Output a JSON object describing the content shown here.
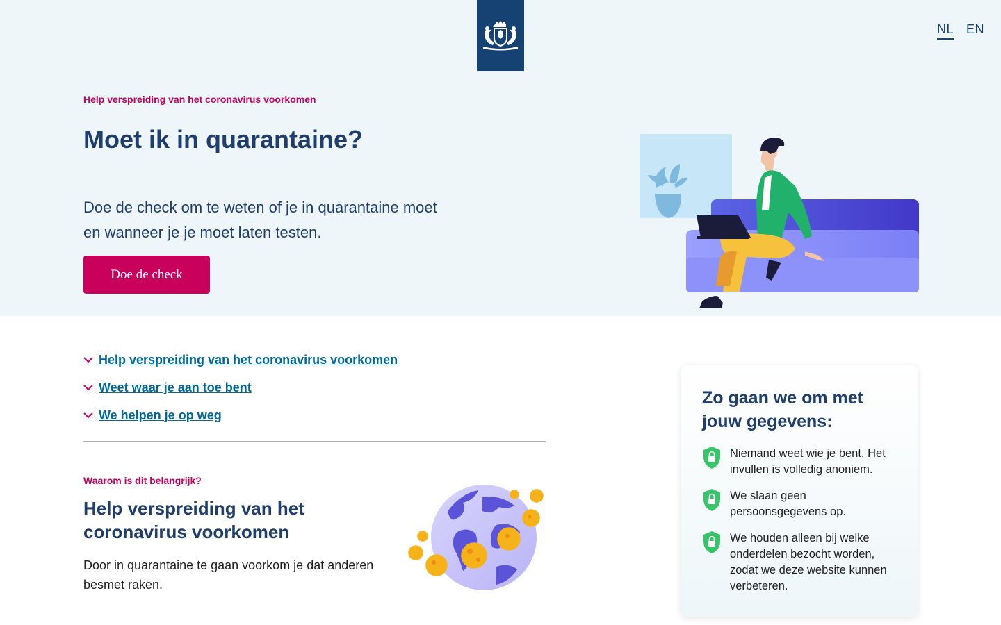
{
  "header": {
    "logo_icon": "dutch-coat-of-arms-logo",
    "languages": [
      {
        "label": "NL",
        "active": true
      },
      {
        "label": "EN",
        "active": false
      }
    ]
  },
  "hero": {
    "eyebrow": "Help verspreiding van het coronavirus voorkomen",
    "title": "Moet ik in quarantaine?",
    "lead": "Doe de check om te weten of je in quarantaine moet en wanneer je je moet laten testen.",
    "cta_label": "Doe de check",
    "illustration_icon": "person-on-couch-with-laptop-illustration"
  },
  "toc": {
    "items": [
      {
        "label": "Help verspreiding van het coronavirus voorkomen"
      },
      {
        "label": "Weet waar je aan toe bent"
      },
      {
        "label": "We helpen je op weg"
      }
    ],
    "chevron_icon": "chevron-down-icon"
  },
  "why": {
    "eyebrow": "Waarom is dit belangrijk?",
    "title": "Help verspreiding van het coronavirus voorkomen",
    "body": "Door in quarantaine te gaan voorkom je dat anderen besmet raken.",
    "illustration_icon": "globe-with-virus-illustration"
  },
  "privacy": {
    "title": "Zo gaan we om met jouw gegevens:",
    "items": [
      {
        "text": "Niemand weet wie je bent. Het invullen is volledig anoniem."
      },
      {
        "text": "We slaan geen persoonsgegevens op."
      },
      {
        "text": "We houden alleen bij welke onderdelen bezocht worden, zodat we deze website kunnen verbeteren."
      }
    ],
    "item_icon": "shield-lock-icon"
  },
  "colors": {
    "brand_blue": "#154273",
    "accent_pink": "#ca005d",
    "link_blue": "#01689b",
    "hero_bg": "#eef6f9"
  }
}
